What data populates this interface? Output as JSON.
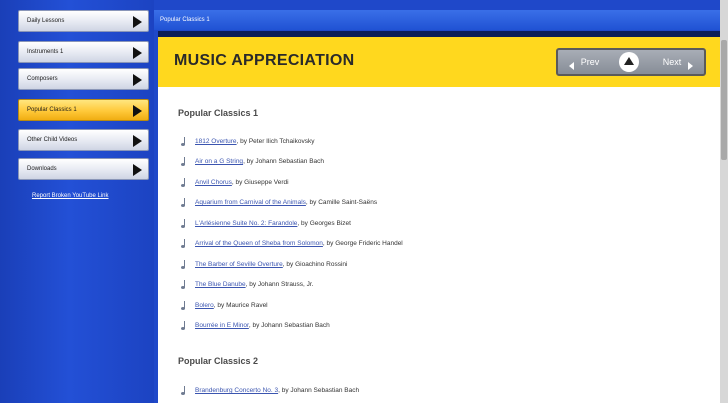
{
  "sidebar": {
    "buttons": [
      {
        "label": "Daily Lessons"
      },
      {
        "label": "Instruments 1"
      },
      {
        "label": "Composers"
      },
      {
        "label": "Popular Classics 1"
      },
      {
        "label": "Other Child Videos"
      },
      {
        "label": "Downloads"
      }
    ],
    "active_index": 3,
    "link": "Report Broken YouTube Link"
  },
  "window": {
    "title": "Popular Classics 1"
  },
  "header": {
    "title": "MUSIC APPRECIATION",
    "prev_label": "Prev",
    "next_label": "Next"
  },
  "sections": [
    {
      "title": "Popular Classics 1",
      "items": [
        {
          "link": "1812 Overture",
          "rest": ", by Peter Ilich Tchaikovsky"
        },
        {
          "link": "Air on a G String",
          "rest": ", by Johann Sebastian Bach"
        },
        {
          "link": "Anvil Chorus",
          "rest": ", by Giuseppe Verdi"
        },
        {
          "link": "Aquarium from Carnival of the Animals",
          "rest": ", by Camille Saint-Saëns"
        },
        {
          "link": "L'Arlésienne Suite No. 2: Farandole",
          "rest": ", by Georges Bizet"
        },
        {
          "link": "Arrival of the Queen of Sheba from Solomon",
          "rest": ", by George Frideric Handel"
        },
        {
          "link": "The Barber of Seville Overture",
          "rest": ", by Gioachino Rossini"
        },
        {
          "link": "The Blue Danube",
          "rest": ", by Johann Strauss, Jr."
        },
        {
          "link": "Bolero",
          "rest": ", by Maurice Ravel"
        },
        {
          "link": "Bourrée in E Minor",
          "rest": ", by Johann Sebastian Bach"
        }
      ]
    },
    {
      "title": "Popular Classics 2",
      "items": [
        {
          "link": "Brandenburg Concerto No. 3",
          "rest": ", by Johann Sebastian Bach"
        }
      ]
    }
  ],
  "colors": {
    "sidebar_blue": "#2350d6",
    "header_yellow": "#ffd81e",
    "active_orange": "#f0ad12",
    "link_blue": "#3b55b0"
  }
}
